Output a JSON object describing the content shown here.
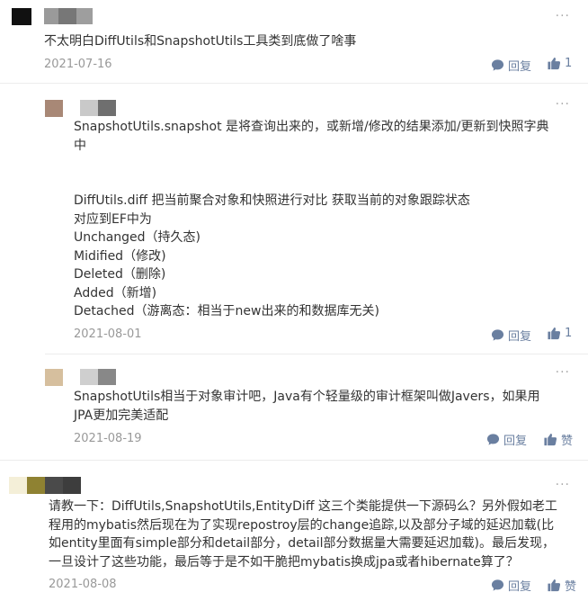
{
  "comments": [
    {
      "text": "不太明白DiffUtils和SnapshotUtils工具类到底做了啥事",
      "date": "2021-07-16",
      "reply_label": "回复",
      "like_count": "1"
    },
    {
      "text": "SnapshotUtils.snapshot 是将查询出来的，或新增/修改的结果添加/更新到快照字典\n中\n\n\nDiffUtils.diff 把当前聚合对象和快照进行对比 获取当前的对象跟踪状态\n对应到EF中为\nUnchanged（持久态)\nMidified（修改)\nDeleted（删除)\nAdded（新增)\nDetached（游离态：相当于new出来的和数据库无关)",
      "date": "2021-08-01",
      "reply_label": "回复",
      "like_count": "1"
    },
    {
      "text": "SnapshotUtils相当于对象审计吧，Java有个轻量级的审计框架叫做Javers，如果用\nJPA更加完美适配",
      "date": "2021-08-19",
      "reply_label": "回复",
      "like_label": "赞"
    },
    {
      "text": "请教一下：DiffUtils,SnapshotUtils,EntityDiff 这三个类能提供一下源码么？另外假如老工\n程用的mybatis然后现在为了实现repostroy层的change追踪,以及部分子域的延迟加载(比\n如entity里面有simple部分和detail部分，detail部分数据量大需要延迟加载)。最后发现，\n一旦设计了这些功能，最后等于是不如干脆把mybatis换成jpa或者hibernate算了？",
      "date": "2021-08-08",
      "reply_label": "回复",
      "like_label": "赞"
    }
  ],
  "icons": {
    "reply": "comment-bubble-icon",
    "like": "thumbs-up-icon",
    "more": "more-dots-icon"
  },
  "colors": {
    "action": "#6a7fa0",
    "date": "#999999",
    "text": "#333333"
  }
}
